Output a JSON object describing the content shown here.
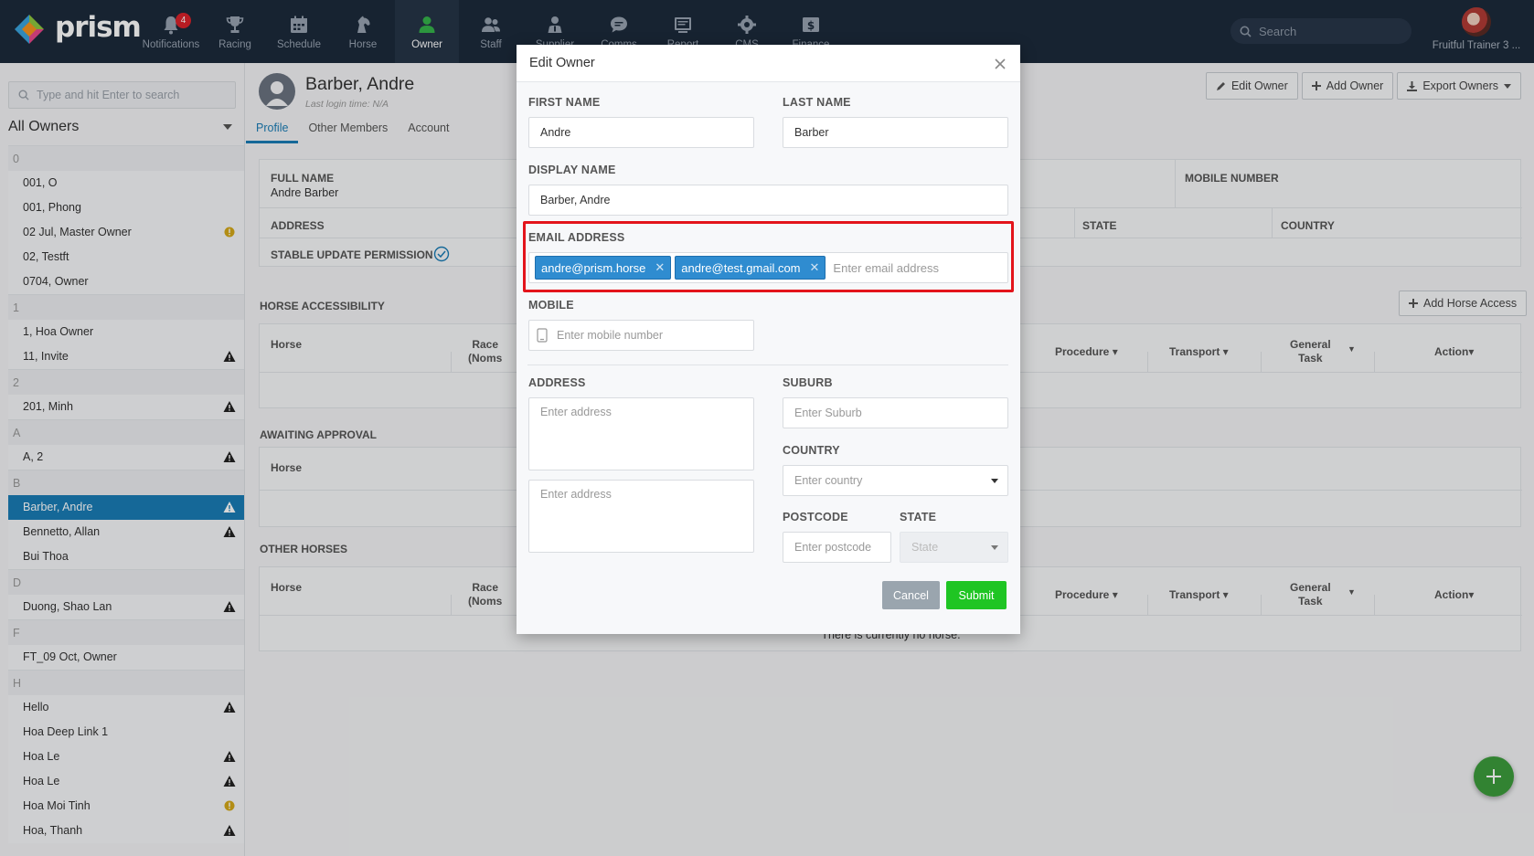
{
  "app": {
    "logo_text": "prism"
  },
  "nav": {
    "items": [
      {
        "label": "Notifications",
        "icon": "bell-icon",
        "badge": "4"
      },
      {
        "label": "Racing",
        "icon": "trophy-icon"
      },
      {
        "label": "Schedule",
        "icon": "calendar-icon"
      },
      {
        "label": "Horse",
        "icon": "horse-head-icon"
      },
      {
        "label": "Owner",
        "icon": "person-icon",
        "active": true
      },
      {
        "label": "Staff",
        "icon": "people-icon"
      },
      {
        "label": "Supplier",
        "icon": "supplier-icon"
      },
      {
        "label": "Comms",
        "icon": "chat-icon"
      },
      {
        "label": "Report",
        "icon": "report-icon"
      },
      {
        "label": "CMS",
        "icon": "gear-icon"
      },
      {
        "label": "Finance",
        "icon": "dollar-icon"
      }
    ],
    "search_label": "Search",
    "user_label": "Fruitful Trainer 3 ..."
  },
  "sidebar": {
    "search_placeholder": "Type and hit Enter to search",
    "filter_label": "All Owners",
    "groups": [
      {
        "letter": "0",
        "rows": [
          {
            "name": "001, O"
          },
          {
            "name": "001, Phong"
          },
          {
            "name": "02 Jul, Master Owner",
            "flag": "info"
          },
          {
            "name": "02, Testft"
          },
          {
            "name": "0704, Owner"
          }
        ]
      },
      {
        "letter": "1",
        "rows": [
          {
            "name": "1, Hoa Owner"
          },
          {
            "name": "11, Invite",
            "flag": "warn"
          }
        ]
      },
      {
        "letter": "2",
        "rows": [
          {
            "name": "201, Minh",
            "flag": "warn"
          }
        ]
      },
      {
        "letter": "A",
        "rows": [
          {
            "name": "A, 2",
            "flag": "warn"
          }
        ]
      },
      {
        "letter": "B",
        "rows": [
          {
            "name": "Barber, Andre",
            "flag": "warn",
            "selected": true
          },
          {
            "name": "Bennetto, Allan",
            "flag": "warn"
          },
          {
            "name": "Bui Thoa"
          }
        ]
      },
      {
        "letter": "D",
        "rows": [
          {
            "name": "Duong, Shao Lan",
            "flag": "warn"
          }
        ]
      },
      {
        "letter": "F",
        "rows": [
          {
            "name": "FT_09 Oct, Owner"
          }
        ]
      },
      {
        "letter": "H",
        "rows": [
          {
            "name": "Hello",
            "flag": "warn"
          },
          {
            "name": "Hoa Deep Link 1"
          },
          {
            "name": "Hoa Le",
            "flag": "warn"
          },
          {
            "name": "Hoa Le",
            "flag": "warn"
          },
          {
            "name": "Hoa Moi Tinh",
            "flag": "info"
          },
          {
            "name": "Hoa, Thanh",
            "flag": "warn"
          }
        ]
      }
    ]
  },
  "profile": {
    "name": "Barber, Andre",
    "last_login": "Last login time: N/A",
    "tabs": [
      "Profile",
      "Other Members",
      "Account"
    ],
    "buttons": {
      "edit": "Edit Owner",
      "add": "Add Owner",
      "export": "Export Owners"
    },
    "full_name_label": "FULL NAME",
    "full_name_value": "Andre Barber",
    "mobile_number_label": "MOBILE NUMBER",
    "address_label": "ADDRESS",
    "state_label": "STATE",
    "country_label": "COUNTRY",
    "stable_perm_label": "STABLE UPDATE PERMISSION",
    "horse_access_title": "HORSE ACCESSIBILITY",
    "add_horse_access": "Add Horse Access",
    "awaiting_title": "AWAITING APPROVAL",
    "other_horses_title": "OTHER HORSES",
    "cols": {
      "horse": "Horse",
      "race": "Race",
      "noms": "(Noms",
      "procedure": "Procedure",
      "transport": "Transport",
      "general": "General",
      "task": "Task",
      "action": "Action"
    },
    "no_horse_text": "There is currently no horse."
  },
  "modal": {
    "title": "Edit Owner",
    "first_name_label": "FIRST NAME",
    "first_name_value": "Andre",
    "last_name_label": "LAST NAME",
    "last_name_value": "Barber",
    "display_name_label": "DISPLAY NAME",
    "display_name_value": "Barber, Andre",
    "email_label": "EMAIL ADDRESS",
    "emails": [
      "andre@prism.horse",
      "andre@test.gmail.com"
    ],
    "email_placeholder": "Enter email address",
    "mobile_label": "MOBILE",
    "mobile_placeholder": "Enter mobile number",
    "address_label": "ADDRESS",
    "address_placeholder_1": "Enter address",
    "address_placeholder_2": "Enter address",
    "suburb_label": "SUBURB",
    "suburb_placeholder": "Enter Suburb",
    "country_label": "COUNTRY",
    "country_placeholder": "Enter country",
    "postcode_label": "POSTCODE",
    "postcode_placeholder": "Enter postcode",
    "state_label": "STATE",
    "state_placeholder": "State",
    "cancel_label": "Cancel",
    "submit_label": "Submit"
  },
  "colors": {
    "nav_bg": "#1c2a3b",
    "accent": "#1a7db6",
    "submit": "#1fc523",
    "highlight": "#e3141b",
    "tag": "#2f8cd0"
  }
}
